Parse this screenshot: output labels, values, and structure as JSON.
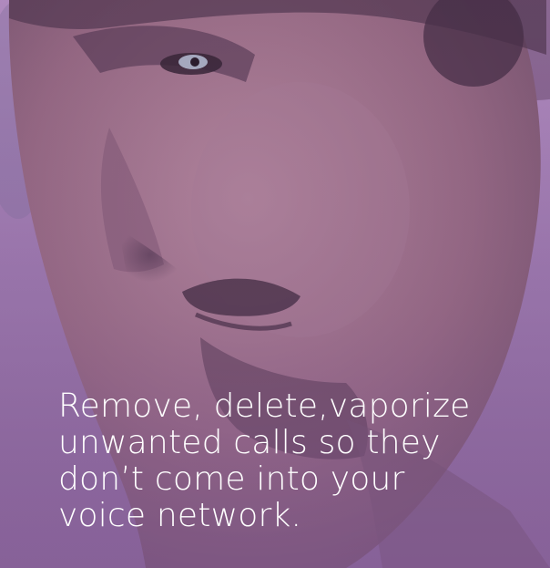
{
  "caption": {
    "lines": [
      "Remove, delete,vaporize",
      "unwanted calls so they",
      "don’t come into your",
      "voice network."
    ]
  },
  "colors": {
    "tint": "#8d6b9c",
    "text": "#ffffff"
  }
}
